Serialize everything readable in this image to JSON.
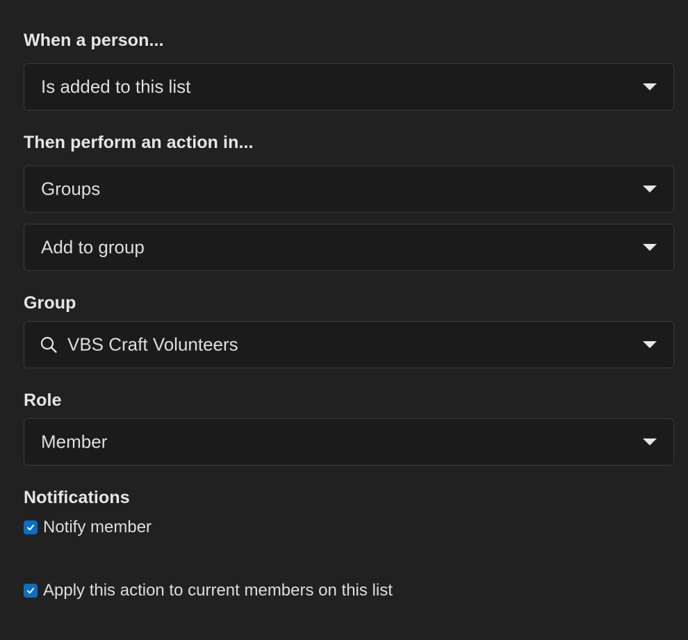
{
  "trigger": {
    "label": "When a person...",
    "selected": "Is added to this list"
  },
  "action": {
    "label": "Then perform an action in...",
    "module_selected": "Groups",
    "action_selected": "Add to group"
  },
  "group": {
    "label": "Group",
    "selected": "VBS Craft Volunteers",
    "icon": "search-icon"
  },
  "role": {
    "label": "Role",
    "selected": "Member"
  },
  "notifications": {
    "label": "Notifications",
    "notify_member": {
      "label": "Notify member",
      "checked": true
    }
  },
  "apply_current": {
    "label": "Apply this action to current members on this list",
    "checked": true
  },
  "colors": {
    "background": "#212121",
    "field_background": "#1b1b1b",
    "field_border": "#3a3a3a",
    "checkbox": "#0a6fc2"
  }
}
